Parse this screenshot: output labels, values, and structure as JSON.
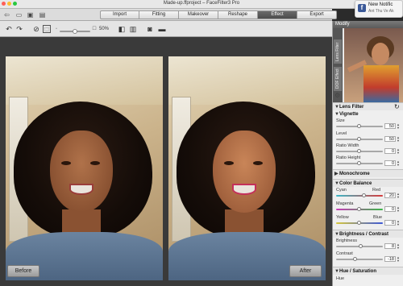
{
  "window": {
    "title": "Made-up.ffproject – FaceFilter3 Pro"
  },
  "tabs": [
    {
      "label": "Import",
      "active": false
    },
    {
      "label": "Fitting",
      "active": false
    },
    {
      "label": "Makeover",
      "active": false
    },
    {
      "label": "Reshape",
      "active": false
    },
    {
      "label": "Effect",
      "active": true
    },
    {
      "label": "Export",
      "active": false
    }
  ],
  "toolbar": {
    "zoom_label": "50%",
    "zoom_value": 50
  },
  "photos": {
    "before_label": "Before",
    "after_label": "After"
  },
  "panel": {
    "header": "Modify",
    "side_tabs": [
      "Lens Filter",
      "DOF Effect"
    ],
    "sections": {
      "lens_filter": "Lens Filter",
      "vignette": "Vignette",
      "monochrome": "Monochrome",
      "color_balance": "Color Balance",
      "brightness_contrast": "Brightness / Contrast",
      "hue_saturation": "Hue / Saturation"
    },
    "vignette": {
      "size": {
        "label": "Size",
        "value": "50",
        "level": 0.5
      },
      "level": {
        "label": "Level",
        "value": "50",
        "level": 0.5
      },
      "ratio_width": {
        "label": "Ratio Width",
        "value": "0",
        "level": 0.5
      },
      "ratio_height": {
        "label": "Ratio Height",
        "value": "0",
        "level": 0.5
      }
    },
    "color_balance": {
      "cyan_red": {
        "left": "Cyan",
        "right": "Red",
        "value": "20",
        "level": 0.6
      },
      "magenta_green": {
        "left": "Magenta",
        "right": "Green",
        "value": "0",
        "level": 0.5
      },
      "yellow_blue": {
        "left": "Yellow",
        "right": "Blue",
        "value": "0",
        "level": 0.5
      }
    },
    "brightness_contrast": {
      "brightness": {
        "label": "Brightness",
        "value": "8",
        "level": 0.54
      },
      "contrast": {
        "label": "Contrast",
        "value": "-18",
        "level": 0.42
      }
    },
    "hue_label": "Hue"
  },
  "notification": {
    "title": "New Notific",
    "body": "Ant Thu Ve Ak"
  }
}
